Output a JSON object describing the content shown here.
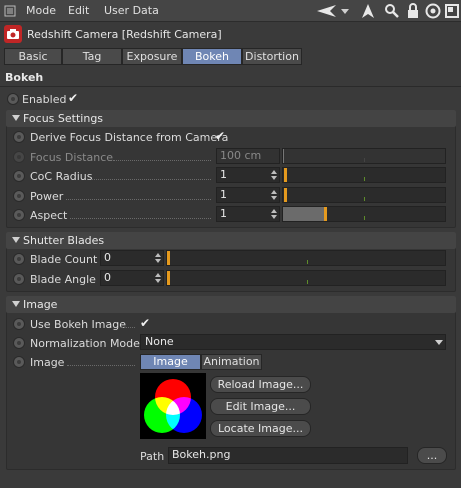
{
  "menu": {
    "mode": "Mode",
    "edit": "Edit",
    "user_data": "User Data"
  },
  "object": {
    "title": "Redshift Camera [Redshift Camera]"
  },
  "tabs": [
    {
      "label": "Basic",
      "active": false
    },
    {
      "label": "Tag",
      "active": false
    },
    {
      "label": "Exposure",
      "active": false
    },
    {
      "label": "Bokeh",
      "active": true
    },
    {
      "label": "Distortion",
      "active": false
    }
  ],
  "section_title": "Bokeh",
  "enabled": {
    "label": "Enabled",
    "checked": "✔"
  },
  "focus_settings": {
    "title": "Focus Settings",
    "derive": {
      "label": "Derive Focus Distance from Camera",
      "checked": "✔"
    },
    "focus_distance": {
      "label": "Focus Distance",
      "value": "100 cm"
    },
    "coc_radius": {
      "label": "CoC Radius",
      "value": "1"
    },
    "power": {
      "label": "Power",
      "value": "1"
    },
    "aspect": {
      "label": "Aspect",
      "value": "1"
    }
  },
  "shutter_blades": {
    "title": "Shutter Blades",
    "blade_count": {
      "label": "Blade Count",
      "value": "0"
    },
    "blade_angle": {
      "label": "Blade Angle",
      "value": "0"
    }
  },
  "image_group": {
    "title": "Image",
    "use_bokeh_image": {
      "label": "Use Bokeh Image",
      "checked": "✔"
    },
    "normalization_mode": {
      "label": "Normalization Mode",
      "value": "None"
    },
    "image": {
      "label": "Image"
    },
    "subtabs": {
      "image": "Image",
      "animation": "Animation"
    },
    "buttons": {
      "reload": "Reload Image...",
      "edit": "Edit Image...",
      "locate": "Locate Image..."
    },
    "path": {
      "label": "Path",
      "value": "Bokeh.png",
      "browse": "..."
    }
  }
}
